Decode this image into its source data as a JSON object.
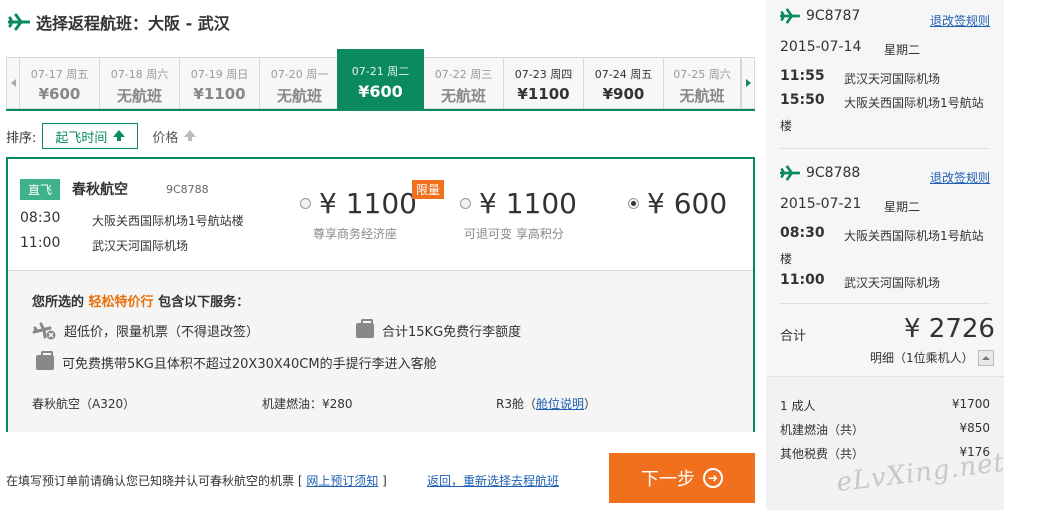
{
  "header": {
    "title": "选择返程航班：大阪 - 武汉"
  },
  "date_strip": [
    {
      "date": "07-17",
      "weekday": "周五",
      "price": "¥600",
      "style": "normal"
    },
    {
      "date": "07-18",
      "weekday": "周六",
      "price": "无航班",
      "style": "normal"
    },
    {
      "date": "07-19",
      "weekday": "周日",
      "price": "¥1100",
      "style": "normal"
    },
    {
      "date": "07-20",
      "weekday": "周一",
      "price": "无航班",
      "style": "normal"
    },
    {
      "date": "07-21",
      "weekday": "周二",
      "price": "¥600",
      "style": "active"
    },
    {
      "date": "07-22",
      "weekday": "周三",
      "price": "无航班",
      "style": "normal"
    },
    {
      "date": "07-23",
      "weekday": "周四",
      "price": "¥1100",
      "style": "dark"
    },
    {
      "date": "07-24",
      "weekday": "周五",
      "price": "¥900",
      "style": "dark"
    },
    {
      "date": "07-25",
      "weekday": "周六",
      "price": "无航班",
      "style": "normal"
    }
  ],
  "sort": {
    "label": "排序:",
    "time_label": "起飞时间",
    "price_label": "价格"
  },
  "flight": {
    "direct": "直飞",
    "airline": "春秋航空",
    "flight_no": "9C8788",
    "depart_time": "08:30",
    "depart_airport": "大阪关西国际机场1号航站楼",
    "arrive_time": "11:00",
    "arrive_airport": "武汉天河国际机场",
    "fares": [
      {
        "price": "¥ 1100",
        "desc": "尊享商务经济座",
        "selected": false
      },
      {
        "price": "¥ 1100",
        "desc": "可退可变 享高积分",
        "selected": false
      },
      {
        "price": "¥ 600",
        "desc": "",
        "selected": true
      }
    ],
    "limit_badge": "限量"
  },
  "services": {
    "prefix": "您所选的",
    "highlight": "轻松特价行",
    "suffix": "包含以下服务：",
    "items": [
      "超低价，限量机票（不得退改签）",
      "合计15KG免费行李额度",
      "可免费携带5KG且体积不超过20X30X40CM的手提行李进入客舱"
    ],
    "aircraft": "春秋航空（A320）",
    "fuel": "机建燃油：¥280",
    "cabin_prefix": "R3舱（",
    "cabin_link": "舱位说明",
    "cabin_suffix": "）"
  },
  "footer": {
    "notice_text": "在填写预订单前请确认您已知晓并认可春秋航空的机票 [",
    "notice_link": "网上预订须知",
    "notice_end": "]",
    "back_link": "返回，重新选择去程航班",
    "next_label": "下一步"
  },
  "summary": {
    "segments": [
      {
        "flight_no": "9C8787",
        "rule": "退改签规则",
        "date": "2015-07-14",
        "weekday": "星期二",
        "dep_time": "11:55",
        "dep_airport": "武汉天河国际机场",
        "arr_time": "15:50",
        "arr_airport": "大阪关西国际机场1号航站",
        "arr_wrap": "楼"
      },
      {
        "flight_no": "9C8788",
        "rule": "退改签规则",
        "date": "2015-07-21",
        "weekday": "星期二",
        "dep_time": "08:30",
        "dep_airport": "大阪关西国际机场1号航站",
        "dep_wrap": "楼",
        "arr_time": "11:00",
        "arr_airport": "武汉天河国际机场"
      }
    ],
    "total_label": "合计",
    "total": "¥ 2726",
    "detail": "明细（1位乘机人）",
    "breakdown": [
      {
        "label": "1 成人",
        "value": "¥1700"
      },
      {
        "label": "机建燃油（共）",
        "value": "¥850"
      },
      {
        "label": "其他税费（共）",
        "value": "¥176"
      }
    ]
  },
  "watermark": "eLvXing.net",
  "colors": {
    "brand_green": "#0b8a5e",
    "orange": "#f0701e",
    "link_blue": "#1f5fb4"
  }
}
